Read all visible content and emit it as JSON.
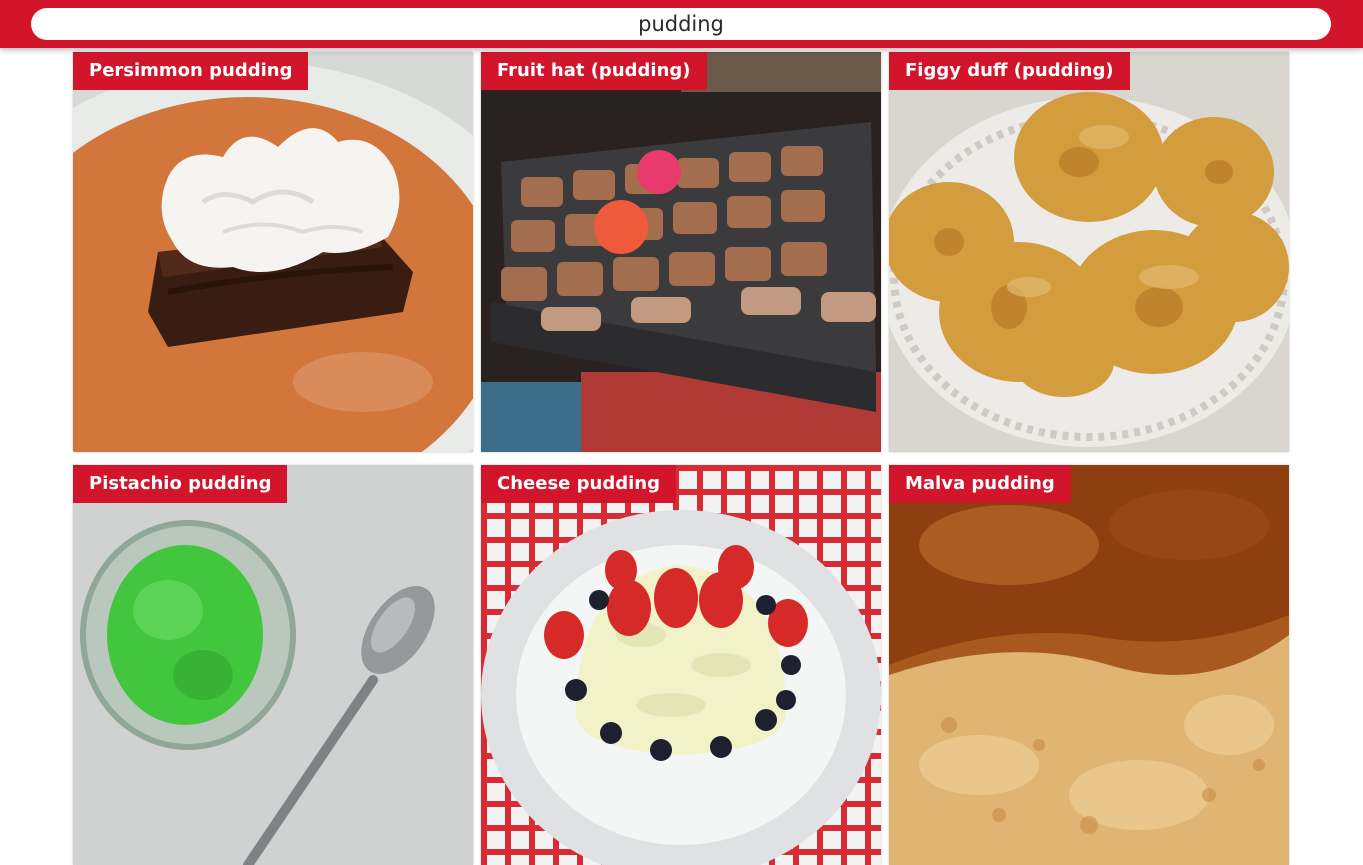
{
  "search": {
    "value": "pudding"
  },
  "results": [
    {
      "name": "Persimmon pudding",
      "photo_icon": "persimmon-pudding-photo"
    },
    {
      "name": "Fruit hat (pudding)",
      "photo_icon": "fruit-hat-pudding-photo"
    },
    {
      "name": "Figgy duff (pudding)",
      "photo_icon": "figgy-duff-pudding-photo"
    },
    {
      "name": "Pistachio pudding",
      "photo_icon": "pistachio-pudding-photo"
    },
    {
      "name": "Cheese pudding",
      "photo_icon": "cheese-pudding-photo"
    },
    {
      "name": "Malva pudding",
      "photo_icon": "malva-pudding-photo"
    }
  ],
  "colors": {
    "accent": "#d3152c",
    "label_text": "#ffffff",
    "background": "#ffffff"
  }
}
